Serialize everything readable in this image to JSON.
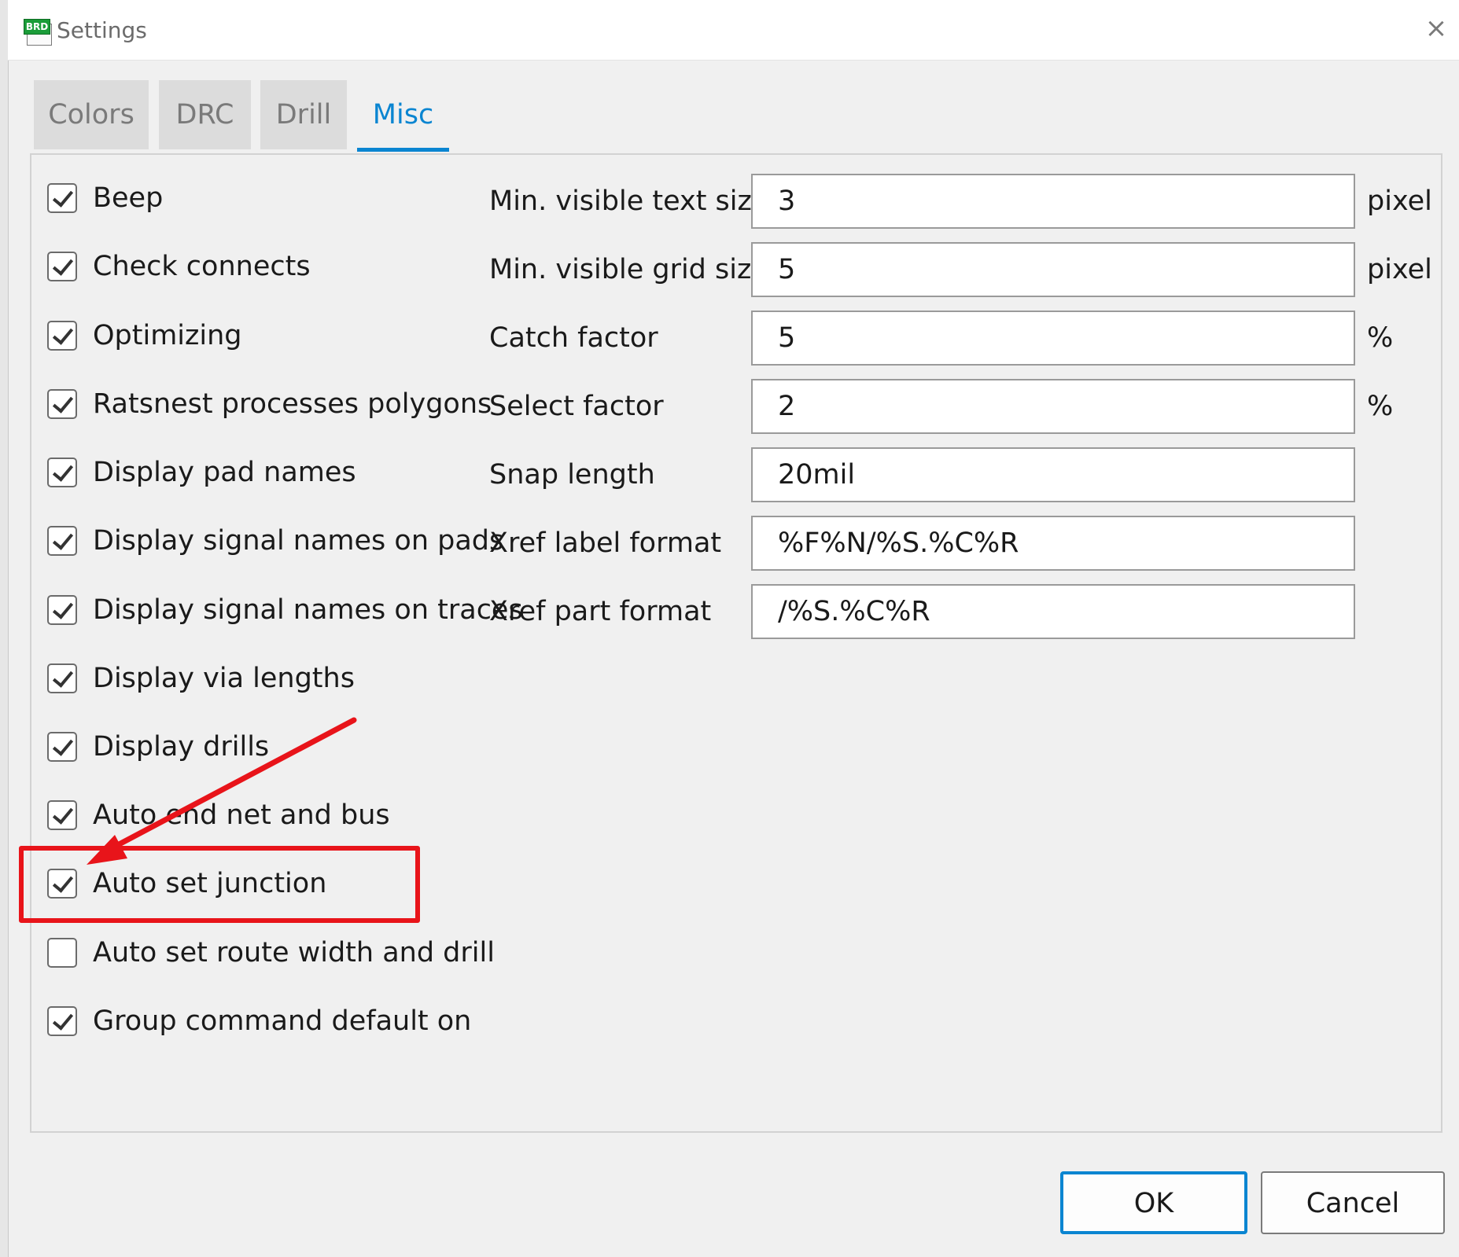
{
  "window": {
    "app_icon_text": "BRD",
    "title": "Settings",
    "close_glyph": "×"
  },
  "tabs": [
    {
      "label": "Colors",
      "active": false
    },
    {
      "label": "DRC",
      "active": false
    },
    {
      "label": "Drill",
      "active": false
    },
    {
      "label": "Misc",
      "active": true
    }
  ],
  "checkboxes": [
    {
      "label": "Beep",
      "checked": true
    },
    {
      "label": "Check connects",
      "checked": true
    },
    {
      "label": "Optimizing",
      "checked": true
    },
    {
      "label": "Ratsnest processes polygons",
      "checked": true
    },
    {
      "label": "Display pad names",
      "checked": true
    },
    {
      "label": "Display signal names on pads",
      "checked": true
    },
    {
      "label": "Display signal names on traces",
      "checked": true
    },
    {
      "label": "Display via lengths",
      "checked": true
    },
    {
      "label": "Display drills",
      "checked": true
    },
    {
      "label": "Auto end net and bus",
      "checked": true
    },
    {
      "label": "Auto set junction",
      "checked": true
    },
    {
      "label": "Auto set route width and drill",
      "checked": false
    },
    {
      "label": "Group command default on",
      "checked": true
    }
  ],
  "fields": [
    {
      "label": "Min. visible text size",
      "value": "3",
      "unit": "pixel"
    },
    {
      "label": "Min. visible grid size",
      "value": "5",
      "unit": "pixel"
    },
    {
      "label": "Catch factor",
      "value": "5",
      "unit": "%"
    },
    {
      "label": "Select factor",
      "value": "2",
      "unit": "%"
    },
    {
      "label": "Snap length",
      "value": "20mil",
      "unit": ""
    },
    {
      "label": "Xref label format",
      "value": "%F%N/%S.%C%R",
      "unit": ""
    },
    {
      "label": "Xref part format",
      "value": "/%S.%C%R",
      "unit": ""
    }
  ],
  "buttons": {
    "ok": "OK",
    "cancel": "Cancel"
  },
  "annotation": {
    "color": "#e8141a",
    "highlighted_item": "Auto set junction"
  },
  "colors": {
    "accent": "#0a85d1",
    "annotation_red": "#e8141a"
  }
}
